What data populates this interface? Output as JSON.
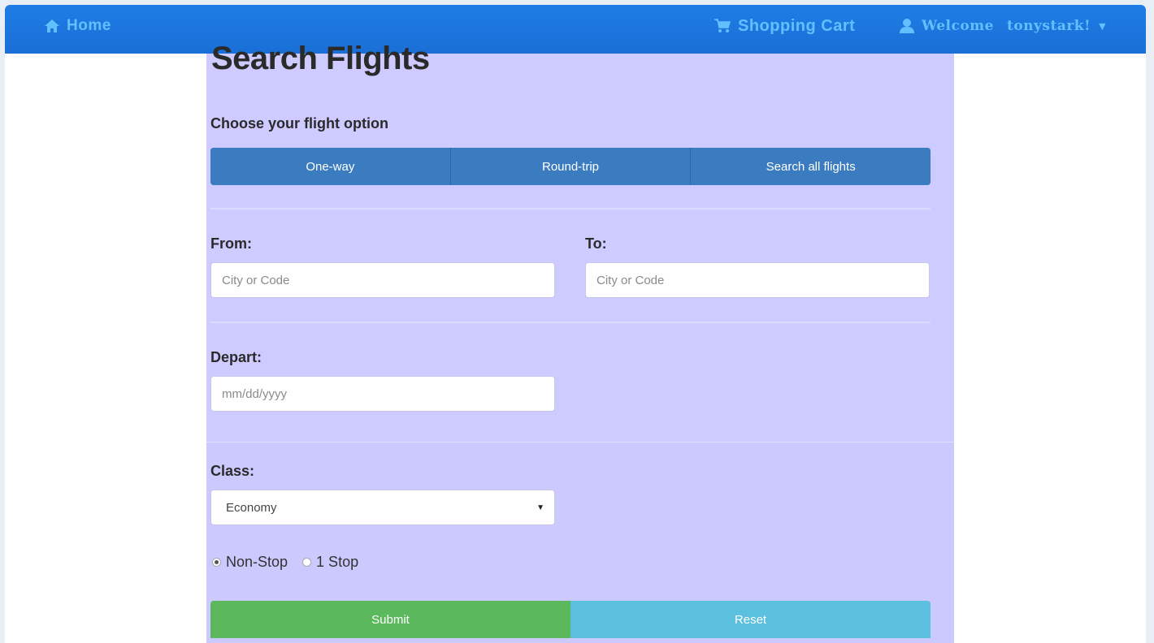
{
  "nav": {
    "home_label": "Home",
    "cart_label": "Shopping Cart",
    "welcome_label": "Welcome",
    "username": "tonystark!",
    "dropdown_caret": "▼"
  },
  "form": {
    "title": "Search Flights",
    "subtitle": "Choose your flight option",
    "options": [
      "One-way",
      "Round-trip",
      "Search all flights"
    ],
    "from_label": "From:",
    "from_placeholder": "City or Code",
    "to_label": "To:",
    "to_placeholder": "City or Code",
    "depart_label": "Depart:",
    "depart_placeholder": "mm/dd/yyyy",
    "class_label": "Class:",
    "class_selected": "Economy",
    "stops": [
      {
        "label": "Non-Stop",
        "checked": true
      },
      {
        "label": "1 Stop",
        "checked": false
      }
    ],
    "submit_label": "Submit",
    "reset_label": "Reset"
  },
  "colors": {
    "navbar": "#1a72d9",
    "nav_text": "#63c0ff",
    "panel": "#cdcbff",
    "segment": "#3b7cc0",
    "submit": "#5cb85c",
    "reset": "#5bc0de"
  },
  "icons": {
    "home": "home-icon",
    "cart": "cart-icon",
    "user": "user-icon"
  }
}
